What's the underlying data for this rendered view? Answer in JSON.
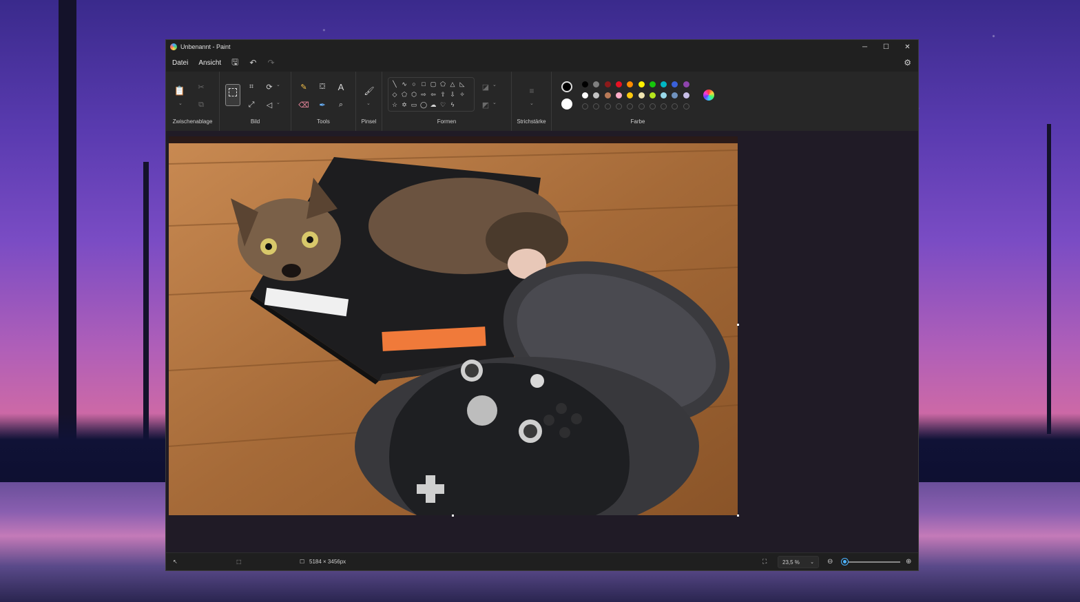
{
  "window": {
    "title": "Unbenannt - Paint",
    "controls": [
      "─",
      "☐",
      "✕"
    ]
  },
  "menu": {
    "file": "Datei",
    "view": "Ansicht",
    "icons": [
      "save-icon",
      "undo-icon",
      "redo-icon",
      "settings-icon"
    ]
  },
  "ribbon": {
    "groups": {
      "clipboard": "Zwischenablage",
      "image": "Bild",
      "tools": "Tools",
      "brush": "Pinsel",
      "shapes": "Formen",
      "stroke": "Strichstärke",
      "color": "Farbe"
    },
    "primary_color": "#000000",
    "secondary_color": "#ffffff",
    "palette_row1": [
      "#000000",
      "#7f7f7f",
      "#8b1a1a",
      "#e81123",
      "#ff8c00",
      "#fff100",
      "#16c60c",
      "#00b7c3",
      "#3a60d9",
      "#8e44ad"
    ],
    "palette_row2": [
      "#ffffff",
      "#c3c3c3",
      "#b97a57",
      "#ffaec9",
      "#ffc90e",
      "#efe4b0",
      "#b5e61d",
      "#99d9ea",
      "#7092be",
      "#c8bfe7"
    ]
  },
  "canvas": {
    "image_alt": "Katze in einem Karton neben einem Xbox Elite Controller"
  },
  "status": {
    "image_size": "5184 × 3456px",
    "zoom": "23,5 %"
  }
}
